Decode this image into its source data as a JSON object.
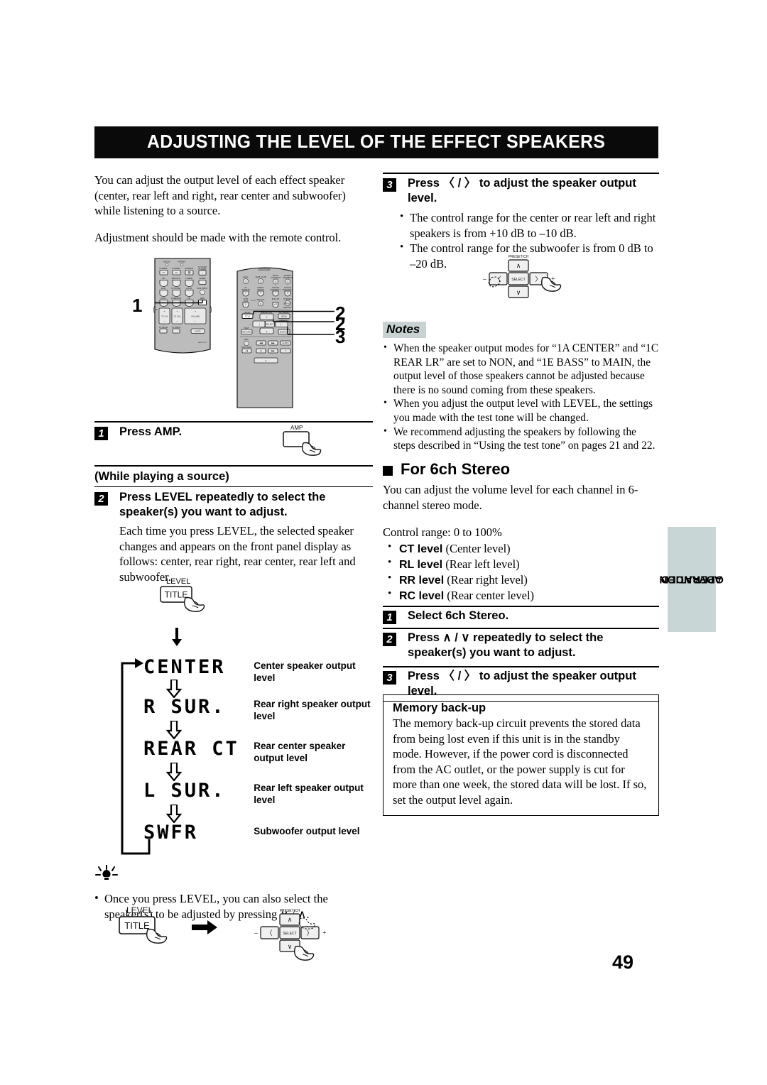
{
  "page": {
    "number": "49",
    "title": "ADJUSTING THE LEVEL OF THE EFFECT SPEAKERS",
    "side_tab": "ADVANCED\nOPERATION",
    "side_tab_line1": "ADVANCED",
    "side_tab_line2": "OPERATION"
  },
  "left": {
    "intro1": "You can adjust the output level of each effect speaker (center, rear left and right, rear center and subwoofer) while listening to a source.",
    "intro2": "Adjustment should be made with the remote control.",
    "callouts": [
      "1",
      "2",
      "2",
      "3"
    ],
    "step1": {
      "num": "1",
      "text": "Press AMP.",
      "button_label": "AMP"
    },
    "while_playing": "(While playing a source)",
    "step2": {
      "num": "2",
      "text": "Press LEVEL repeatedly to select the speaker(s) you want to adjust.",
      "body": "Each time you press LEVEL, the selected speaker changes and appears on the front panel display as follows: center, rear right, rear center, rear left and subwoofer."
    },
    "level_button": {
      "top_label": "LEVEL",
      "face_label": "TITLE"
    },
    "display_flow": [
      {
        "display": "CENTER",
        "caption": "Center speaker output level"
      },
      {
        "display": "R SUR.",
        "caption": "Rear right speaker output level"
      },
      {
        "display": "REAR CT",
        "caption": "Rear center speaker output level"
      },
      {
        "display": "L SUR.",
        "caption": "Rear left speaker output level"
      },
      {
        "display": "SWFR",
        "caption": "Subwoofer output level"
      }
    ],
    "tip": "Once you press LEVEL, you can also select the speaker(s) to be adjusted by pressing  ∨ / ∧."
  },
  "right": {
    "step3": {
      "num": "3",
      "text": "Press 〈 / 〉 to adjust the speaker output level.",
      "bullets": [
        "The control range for the center or rear left and right speakers is from +10 dB to –10 dB.",
        "The control range for the subwoofer is from 0 dB to –20 dB."
      ]
    },
    "notes": {
      "label": "Notes",
      "items": [
        "When the speaker output modes for “1A CENTER” and “1C REAR LR” are set to NON, and “1E BASS” to MAIN, the output level of those speakers cannot be adjusted because there is no sound coming from these speakers.",
        "When you adjust the output level with LEVEL, the settings you made with the test tone will be changed.",
        "We recommend adjusting the speakers by following the steps described in “Using the test tone” on pages 21 and 22."
      ]
    },
    "for6ch": {
      "title": "For 6ch Stereo",
      "intro": "You can adjust the volume level for each channel in 6-channel stereo mode.",
      "control_range": "Control range:   0 to 100%",
      "levels": [
        {
          "name": "CT level",
          "desc": "(Center level)"
        },
        {
          "name": "RL level",
          "desc": "(Rear left level)"
        },
        {
          "name": "RR level",
          "desc": "(Rear right level)"
        },
        {
          "name": "RC level",
          "desc": "(Rear center level)"
        }
      ],
      "steps": [
        {
          "num": "1",
          "text": "Select 6ch Stereo."
        },
        {
          "num": "2",
          "text": "Press ∧ / ∨ repeatedly to select the speaker(s) you want to adjust."
        },
        {
          "num": "3",
          "text": "Press 〈 / 〉 to adjust the speaker output level."
        }
      ]
    },
    "memory": {
      "title": "Memory back-up",
      "body": "The memory back-up circuit prevents the stored data from being lost even if this unit is in the standby mode. However, if the power cord is disconnected from the AC outlet, or the power supply is cut for more than one week, the stored data will be lost. If so, set the output level again."
    }
  },
  "cursor_pad": {
    "preset_label": "PRESET/CH",
    "select_label": "SELECT",
    "up": "∧",
    "down": "∨",
    "left": "〈",
    "right": "〉",
    "minus": "–",
    "plus": "+"
  },
  "remote": {
    "left_unit": {
      "indicators": [
        "DOLBY",
        "TARGET"
      ],
      "row0": [
        "POWER TV",
        "POWER AV",
        "DIMMER",
        "SYSTEM POWER"
      ],
      "row1": [
        "CD",
        "MD/CD-R",
        "TUNER",
        "SLEEP"
      ],
      "row2": [
        "DVD",
        "D-TV/CBL",
        "V-AUX",
        "6CH INPUT"
      ],
      "row3": [
        "VCR 1",
        "VCR2/DVR",
        "CD",
        "AMP"
      ],
      "pads": [
        "TV CH",
        "TV VOL",
        "VOLUME"
      ],
      "small": [
        "TV MUTE",
        "TV INPUT",
        "MUTE"
      ]
    },
    "right_unit": {
      "dsp_row1": [
        "HALL 1",
        "JAZZ CLUB 2",
        "ROCK CONCERT 3",
        "ENTERTAIN 4"
      ],
      "dsp_row2": [
        "TV SPORTS 5",
        "MONO MOVIE 6",
        "MOVIE THEATER 1 7",
        "MOVIE THEATER 2 8"
      ],
      "dsp_row3": [
        "/DTS SUR 9",
        "SELECT 0",
        "6CH ST +10",
        "STEREO EFFECT"
      ],
      "level": "LEVEL TITLE",
      "preset": "PRESET/CH",
      "menu": "SET MENU MENU",
      "test": "TEST RETURN",
      "display": "DISPLAY",
      "rec": "REC",
      "btn_row_a": [
        "REC",
        "POWER",
        "CH/DISC",
        "AUDIO"
      ],
      "btn_row_b": [
        "STOP",
        "PAUSE",
        "CH/DISC",
        "PLAY"
      ],
      "play": "PLAY"
    }
  }
}
